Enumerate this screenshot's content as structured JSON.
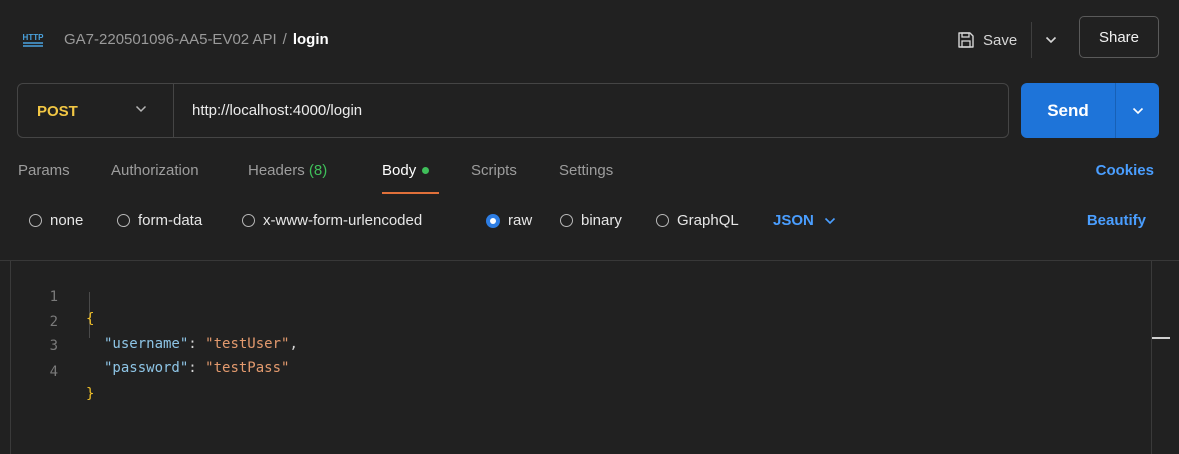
{
  "header": {
    "collection": "GA7-220501096-AA5-EV02 API",
    "separator": "/",
    "request_name": "login",
    "save_label": "Save",
    "share_label": "Share"
  },
  "request": {
    "method": "POST",
    "url": "http://localhost:4000/login",
    "send_label": "Send"
  },
  "tabs": {
    "params": "Params",
    "authorization": "Authorization",
    "headers": "Headers",
    "headers_count": "(8)",
    "body": "Body",
    "scripts": "Scripts",
    "settings": "Settings",
    "active": "Body",
    "cookies": "Cookies"
  },
  "body_types": {
    "none": "none",
    "form_data": "form-data",
    "urlencoded": "x-www-form-urlencoded",
    "raw": "raw",
    "binary": "binary",
    "graphql": "GraphQL",
    "selected": "raw",
    "format": "JSON",
    "beautify": "Beautify"
  },
  "editor": {
    "line_numbers": [
      "1",
      "2",
      "3",
      "4"
    ],
    "open_brace": "{",
    "close_brace": "}",
    "entries": [
      {
        "key": "\"username\"",
        "value": "\"testUser\"",
        "comma": ","
      },
      {
        "key": "\"password\"",
        "value": "\"testPass\"",
        "comma": ""
      }
    ]
  },
  "colors": {
    "background": "#212121",
    "accent_blue": "#1e74d9",
    "link_blue": "#4a9eff",
    "method_yellow": "#f2c744",
    "active_tab_underline": "#e0703a",
    "status_green": "#3fbf5a"
  },
  "icons": [
    "http-icon",
    "save-icon",
    "chevron-down-icon"
  ]
}
